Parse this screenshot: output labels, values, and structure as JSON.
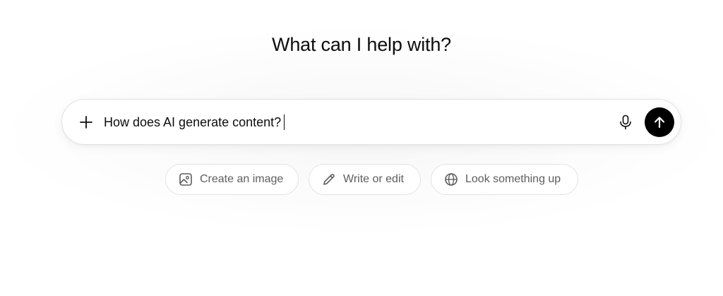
{
  "heading": "What can I help with?",
  "composer": {
    "prompt_text": "How does AI generate content?",
    "icons": {
      "attach": "plus-icon",
      "voice": "microphone-icon",
      "send": "arrow-up-icon"
    },
    "send_button_color": "#000000"
  },
  "suggestions": [
    {
      "label": "Create an image",
      "icon": "image-icon"
    },
    {
      "label": "Write or edit",
      "icon": "pencil-icon"
    },
    {
      "label": "Look something up",
      "icon": "globe-icon"
    }
  ],
  "colors": {
    "text_primary": "#0d0d0d",
    "text_secondary": "#5d5d5d",
    "border": "#e3e3e3"
  }
}
